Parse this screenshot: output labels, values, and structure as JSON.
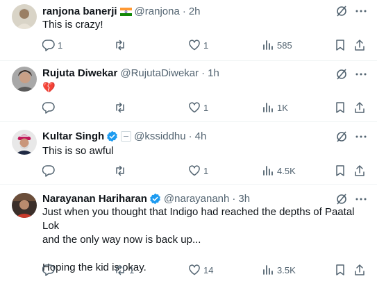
{
  "tweets": [
    {
      "name": "ranjona banerji",
      "handle": "@ranjona",
      "time": "2h",
      "text": "This is crazy!",
      "replies": "1",
      "reposts": "",
      "likes": "1",
      "views": "585",
      "badge": "india-flag-emoji"
    },
    {
      "name": "Rujuta Diwekar",
      "handle": "@RujutaDiwekar",
      "time": "1h",
      "text": "💔",
      "replies": "",
      "reposts": "",
      "likes": "1",
      "views": "1K",
      "badge": ""
    },
    {
      "name": "Kultar Singh",
      "handle": "@kssiddhu",
      "time": "4h",
      "text": "This is so awful",
      "replies": "",
      "reposts": "",
      "likes": "1",
      "views": "4.5K",
      "badge": "verified-badge"
    },
    {
      "name": "Narayanan Hariharan",
      "handle": "@narayananh",
      "time": "3h",
      "text_lines": [
        "Just when you thought that Indigo had reached the depths of Paatal Lok",
        "and the only way now is back up...",
        "",
        "Hoping the kid is okay."
      ],
      "replies": "",
      "reposts": "1",
      "likes": "14",
      "views": "3.5K",
      "badge": "verified-badge"
    }
  ],
  "icons": [
    "reply-icon",
    "repost-icon",
    "like-icon",
    "views-icon",
    "bookmark-icon",
    "share-icon",
    "grok-icon",
    "more-icon"
  ],
  "colors": {
    "text": "#0f1419",
    "muted": "#536471",
    "verified": "#1d9bf0",
    "border": "#eff3f4"
  }
}
